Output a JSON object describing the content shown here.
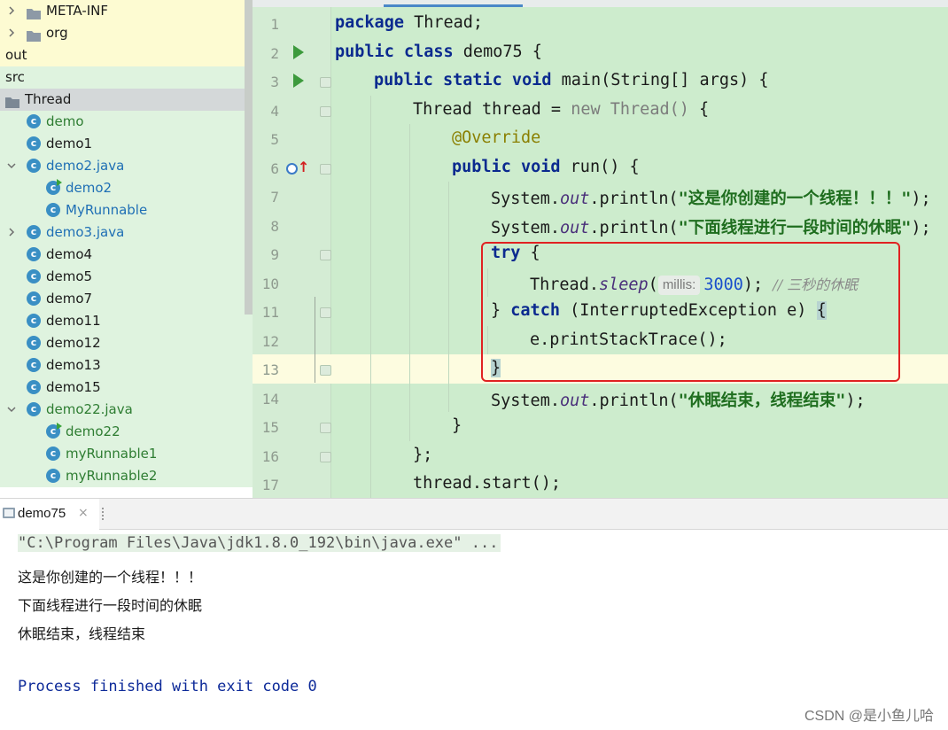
{
  "project_tree": {
    "items": [
      {
        "label": "META-INF",
        "kind": "folder",
        "expand": "collapsed",
        "indent": 1,
        "bg": "yellow",
        "color": "black"
      },
      {
        "label": "org",
        "kind": "folder",
        "expand": "collapsed",
        "indent": 1,
        "bg": "yellow",
        "color": "black"
      },
      {
        "label": "out",
        "kind": "none",
        "expand": "none",
        "indent": 0,
        "bg": "yellow",
        "color": "black"
      },
      {
        "label": "src",
        "kind": "none",
        "expand": "none",
        "indent": 0,
        "bg": "green",
        "color": "black"
      },
      {
        "label": "Thread",
        "kind": "package",
        "expand": "none",
        "indent": 0,
        "bg": "selected",
        "color": "black"
      },
      {
        "label": "demo",
        "kind": "class",
        "expand": "none",
        "indent": 1,
        "bg": "green",
        "color": "green"
      },
      {
        "label": "demo1",
        "kind": "class",
        "expand": "none",
        "indent": 1,
        "bg": "green",
        "color": "black"
      },
      {
        "label": "demo2.java",
        "kind": "class",
        "expand": "expanded",
        "indent": 1,
        "bg": "green",
        "color": "blue"
      },
      {
        "label": "demo2",
        "kind": "class-run",
        "expand": "none",
        "indent": 2,
        "bg": "green",
        "color": "blue"
      },
      {
        "label": "MyRunnable",
        "kind": "class",
        "expand": "none",
        "indent": 2,
        "bg": "green",
        "color": "blue"
      },
      {
        "label": "demo3.java",
        "kind": "class",
        "expand": "collapsed",
        "indent": 1,
        "bg": "green",
        "color": "blue"
      },
      {
        "label": "demo4",
        "kind": "class",
        "expand": "none",
        "indent": 1,
        "bg": "green",
        "color": "black"
      },
      {
        "label": "demo5",
        "kind": "class",
        "expand": "none",
        "indent": 1,
        "bg": "green",
        "color": "black"
      },
      {
        "label": "demo7",
        "kind": "class",
        "expand": "none",
        "indent": 1,
        "bg": "green",
        "color": "black"
      },
      {
        "label": "demo11",
        "kind": "class",
        "expand": "none",
        "indent": 1,
        "bg": "green",
        "color": "black"
      },
      {
        "label": "demo12",
        "kind": "class",
        "expand": "none",
        "indent": 1,
        "bg": "green",
        "color": "black"
      },
      {
        "label": "demo13",
        "kind": "class",
        "expand": "none",
        "indent": 1,
        "bg": "green",
        "color": "black"
      },
      {
        "label": "demo15",
        "kind": "class",
        "expand": "none",
        "indent": 1,
        "bg": "green",
        "color": "black"
      },
      {
        "label": "demo22.java",
        "kind": "class",
        "expand": "expanded",
        "indent": 1,
        "bg": "green",
        "color": "green"
      },
      {
        "label": "demo22",
        "kind": "class-run",
        "expand": "none",
        "indent": 2,
        "bg": "green",
        "color": "green"
      },
      {
        "label": "myRunnable1",
        "kind": "class",
        "expand": "none",
        "indent": 2,
        "bg": "green",
        "color": "green"
      },
      {
        "label": "myRunnable2",
        "kind": "class",
        "expand": "none",
        "indent": 2,
        "bg": "green",
        "color": "green"
      }
    ]
  },
  "editor": {
    "current_line": 13,
    "lines": [
      {
        "n": "1",
        "indent": 0,
        "tokens": [
          [
            "kw",
            "package"
          ],
          [
            "p",
            " Thread;"
          ]
        ]
      },
      {
        "n": "2",
        "indent": 0,
        "run": true,
        "tokens": [
          [
            "kw",
            "public class"
          ],
          [
            "p",
            " demo75 {"
          ]
        ]
      },
      {
        "n": "3",
        "indent": 1,
        "run": true,
        "fold": true,
        "tokens": [
          [
            "kw",
            "public static void"
          ],
          [
            "p",
            " main(String[] args) {"
          ]
        ]
      },
      {
        "n": "4",
        "indent": 2,
        "fold": true,
        "tokens": [
          [
            "p",
            "Thread thread = "
          ],
          [
            "gray",
            "new Thread() "
          ],
          [
            "p",
            "{"
          ]
        ]
      },
      {
        "n": "5",
        "indent": 3,
        "tokens": [
          [
            "ann",
            "@Override"
          ]
        ]
      },
      {
        "n": "6",
        "indent": 3,
        "override": true,
        "fold": true,
        "tokens": [
          [
            "kw",
            "public void"
          ],
          [
            "p",
            " run() {"
          ]
        ]
      },
      {
        "n": "7",
        "indent": 4,
        "tokens": [
          [
            "p",
            "System."
          ],
          [
            "ital",
            "out"
          ],
          [
            "p",
            ".println("
          ],
          [
            "str",
            "\"这是你创建的一个线程！！！\""
          ],
          [
            "p",
            ");"
          ]
        ]
      },
      {
        "n": "8",
        "indent": 4,
        "tokens": [
          [
            "p",
            "System."
          ],
          [
            "ital",
            "out"
          ],
          [
            "p",
            ".println("
          ],
          [
            "str",
            "\"下面线程进行一段时间的休眠\""
          ],
          [
            "p",
            ");"
          ]
        ]
      },
      {
        "n": "9",
        "indent": 4,
        "fold": true,
        "tokens": [
          [
            "kw",
            "try"
          ],
          [
            "p",
            " {"
          ]
        ]
      },
      {
        "n": "10",
        "indent": 5,
        "tokens": [
          [
            "p",
            "Thread."
          ],
          [
            "ital",
            "sleep"
          ],
          [
            "p",
            "("
          ],
          [
            "hint",
            "millis:"
          ],
          [
            "num",
            "3000"
          ],
          [
            "p",
            "); "
          ],
          [
            "cmt",
            "// 三秒的休眠"
          ]
        ]
      },
      {
        "n": "11",
        "indent": 4,
        "fold": true,
        "tokens": [
          [
            "p",
            "} "
          ],
          [
            "kw",
            "catch"
          ],
          [
            "p",
            " (InterruptedException e) "
          ],
          [
            "brace",
            "{"
          ]
        ]
      },
      {
        "n": "12",
        "indent": 5,
        "tokens": [
          [
            "p",
            "e.printStackTrace();"
          ]
        ]
      },
      {
        "n": "13",
        "indent": 4,
        "fold": true,
        "tokens": [
          [
            "brace",
            "}"
          ]
        ]
      },
      {
        "n": "14",
        "indent": 4,
        "tokens": [
          [
            "p",
            "System."
          ],
          [
            "ital",
            "out"
          ],
          [
            "p",
            ".println("
          ],
          [
            "str",
            "\"休眠结束，线程结束\""
          ],
          [
            "p",
            ");"
          ]
        ]
      },
      {
        "n": "15",
        "indent": 3,
        "fold": true,
        "tokens": [
          [
            "p",
            "}"
          ]
        ]
      },
      {
        "n": "16",
        "indent": 2,
        "fold": true,
        "tokens": [
          [
            "p",
            "};"
          ]
        ]
      },
      {
        "n": "17",
        "indent": 2,
        "tokens": [
          [
            "p",
            "thread.start();"
          ]
        ]
      }
    ]
  },
  "run_panel": {
    "tab_label": "demo75",
    "close_glyph": "×",
    "command": "\"C:\\Program Files\\Java\\jdk1.8.0_192\\bin\\java.exe\" ...",
    "output": [
      "这是你创建的一个线程！！！",
      "下面线程进行一段时间的休眠",
      "休眠结束，线程结束"
    ],
    "finish": "Process finished with exit code 0"
  },
  "watermark": "CSDN @是小鱼儿哈",
  "colors": {
    "editor_bg": "#cdeccd",
    "highlight_box": "#e02222",
    "keyword": "#0b2a8f",
    "string": "#1f6e1f"
  }
}
